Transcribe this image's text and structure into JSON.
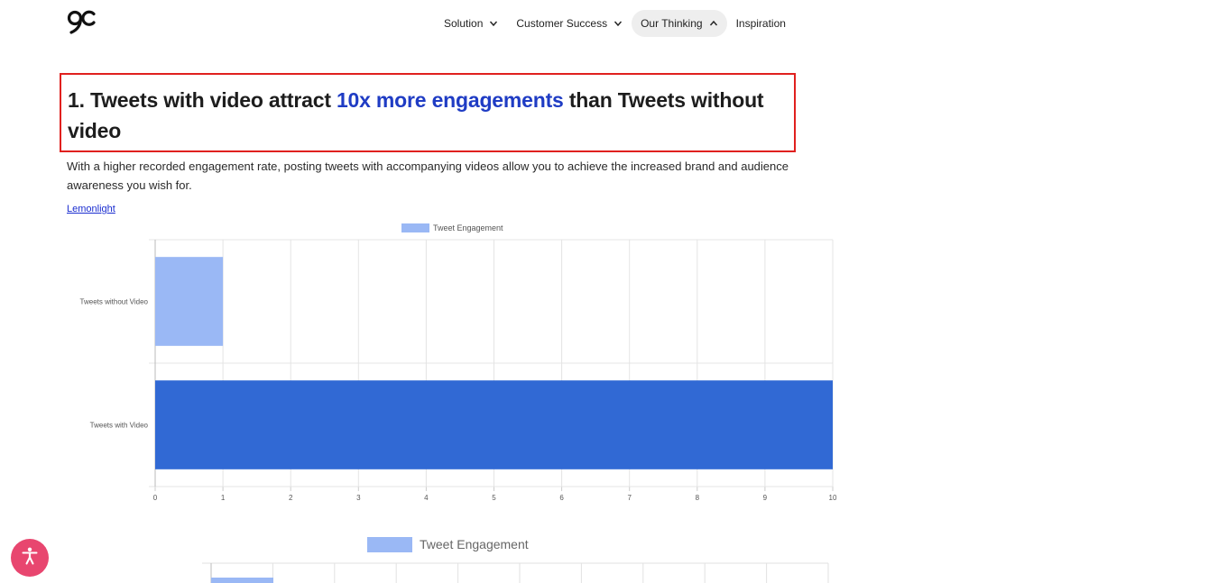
{
  "nav": {
    "items": [
      {
        "label": "Solution",
        "chevron": "down"
      },
      {
        "label": "Customer Success",
        "chevron": "down"
      },
      {
        "label": "Our Thinking",
        "chevron": "up",
        "active": true
      },
      {
        "label": "Inspiration"
      }
    ]
  },
  "article": {
    "heading_prefix": "1. Tweets with video attract ",
    "heading_highlight": "10x more engagements",
    "heading_suffix": " than Tweets without video",
    "paragraph": "With a higher recorded engagement rate, posting tweets with accompanying videos allow you to achieve the increased brand and audience awareness you wish for.",
    "source_link": "Lemonlight"
  },
  "colors": {
    "accent_text": "#1f3cc4",
    "highlight_box": "#e0201e",
    "series_light": "#9ab8f5",
    "series_dark": "#3169d4",
    "a11y_button": "#e8466f"
  },
  "icons": {
    "logo": "brand-logo-icon",
    "chevron": "chevron-icon",
    "accessibility": "accessibility-icon"
  },
  "chart_data": [
    {
      "type": "bar",
      "orientation": "horizontal",
      "categories": [
        "Tweets without Video",
        "Tweets with Video"
      ],
      "series": [
        {
          "name": "Tweet Engagement",
          "values": [
            1,
            10
          ]
        }
      ],
      "bar_colors": [
        "#9ab8f5",
        "#3169d4"
      ],
      "xlim": [
        0,
        10
      ],
      "xticks": [
        0,
        1,
        2,
        3,
        4,
        5,
        6,
        7,
        8,
        9,
        10
      ],
      "grid": true,
      "legend": "top-center"
    },
    {
      "type": "bar",
      "orientation": "horizontal",
      "series": [
        {
          "name": "Tweet Engagement"
        }
      ],
      "legend": "top-center",
      "partially_visible": true
    }
  ]
}
